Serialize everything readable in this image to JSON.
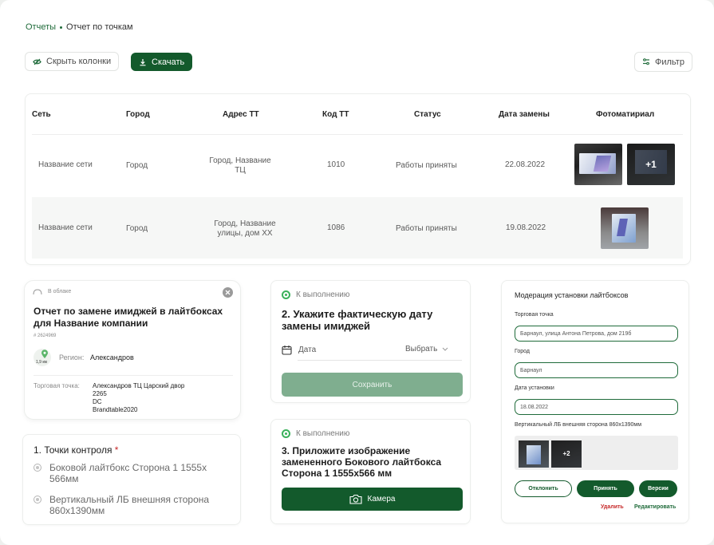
{
  "breadcrumb": {
    "parent": "Отчеты",
    "current": "Отчет по точкам"
  },
  "toolbar": {
    "hide_columns": "Скрыть колонки",
    "download": "Скачать",
    "filter": "Фильтр"
  },
  "table": {
    "headers": [
      "Сеть",
      "Город",
      "Адрес ТТ",
      "Код ТТ",
      "Статус",
      "Дата замены",
      "Фотоматириал"
    ],
    "rows": [
      {
        "network": "Название сети",
        "city": "Город",
        "address_l1": "Город, Название",
        "address_l2": "ТЦ",
        "code": "1010",
        "status": "Работы приняты",
        "date": "22.08.2022",
        "more_photos": "+1"
      },
      {
        "network": "Название сети",
        "city": "Город",
        "address_l1": "Город, Название",
        "address_l2": "улицы, дом XX",
        "code": "1086",
        "status": "Работы приняты",
        "date": "19.08.2022"
      }
    ]
  },
  "report_card": {
    "cloud_label": "В облаке",
    "title": "Отчет по замене имиджей в лайтбоксах для Название компании",
    "id": "# 2624969",
    "distance": "1,9 км",
    "region_label": "Регион:",
    "region_value": "Александров",
    "point_label": "Торговая точка:",
    "point_lines": [
      "Александров ТЦ Царский двор",
      "2265",
      "DC",
      "Brandtable2020"
    ]
  },
  "checkpoints": {
    "title": "1. Точки контроля",
    "required_mark": "*",
    "items": [
      "Боковой лайтбокс Сторона 1  1555x 566мм",
      "Вертикальный ЛБ внешняя сторона 860x1390мм"
    ]
  },
  "task_date": {
    "status": "К выполнению",
    "title": "2. Укажите фактическую дату замены имиджей",
    "date_label": "Дата",
    "select_label": "Выбрать",
    "save_button": "Сохранить"
  },
  "task_photo": {
    "status": "К выполнению",
    "title": "3. Приложите изображение замененного Бокового лайтбокса Сторона 1 1555x566 мм",
    "camera_button": "Камера"
  },
  "moderation": {
    "title": "Модерация установки лайтбоксов",
    "point_label": "Торговая точка",
    "point_value": "Барнаул, улица Антона Петрова, дом 219б",
    "city_label": "Город",
    "city_value": "Барнаул",
    "date_label": "Дата установки",
    "date_value": "18.08.2022",
    "photos_label": "Вертикальный ЛБ внешняя сторона 860x1390мм",
    "more_photos": "+2",
    "reject": "Отклонить",
    "accept": "Принять",
    "versions": "Версии",
    "delete": "Удалить",
    "edit": "Редактировать"
  },
  "colors": {
    "brand": "#135a2c",
    "accent": "#1f6b3a",
    "danger": "#c62828",
    "disabled": "#7fae8f"
  },
  "icons": [
    "eye-slash-icon",
    "download-icon",
    "filter-icon",
    "cloud-icon",
    "close-icon",
    "map-pin-icon",
    "radio-icon",
    "status-ring-icon",
    "calendar-icon",
    "chevron-down-icon",
    "camera-icon"
  ]
}
